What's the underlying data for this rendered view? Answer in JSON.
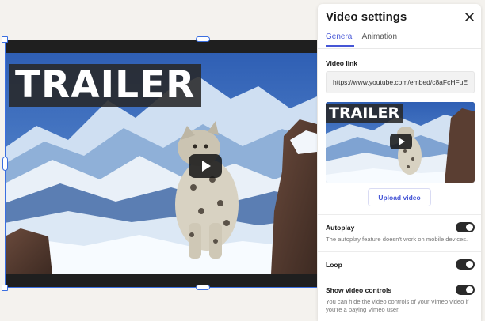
{
  "video": {
    "overlay_text": "TRAILER",
    "play_icon": "play-icon"
  },
  "panel": {
    "title": "Video settings",
    "close_icon": "close-icon",
    "tabs": [
      {
        "label": "General",
        "active": true
      },
      {
        "label": "Animation",
        "active": false
      }
    ],
    "video_link": {
      "label": "Video link",
      "value": "https://www.youtube.com/embed/c8aFcHFuE"
    },
    "thumbnail": {
      "overlay_text": "TRAILER"
    },
    "upload_label": "Upload video",
    "autoplay": {
      "label": "Autoplay",
      "enabled": true,
      "help": "The autoplay feature doesn't work on mobile devices."
    },
    "loop": {
      "label": "Loop",
      "enabled": true
    },
    "show_controls": {
      "label": "Show video controls",
      "enabled": true,
      "help": "You can hide the video controls of your Vimeo video if you're a paying Vimeo user."
    }
  },
  "colors": {
    "accent": "#4656d6",
    "selection": "#3b6fe0",
    "toggle_on": "#2a2a2a",
    "canvas_bg": "#f4f2ee"
  }
}
